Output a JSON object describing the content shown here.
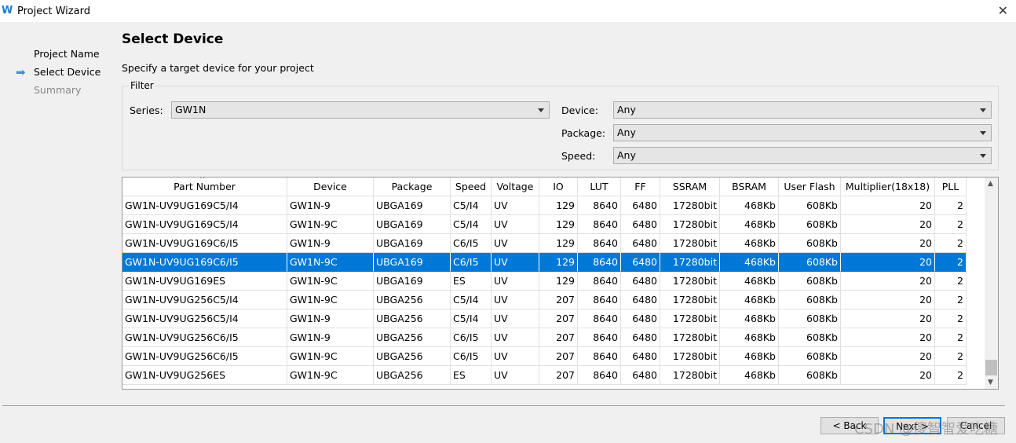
{
  "window": {
    "title": "Project Wizard"
  },
  "steps": [
    {
      "label": "Project Name",
      "state": "done"
    },
    {
      "label": "Select Device",
      "state": "current"
    },
    {
      "label": "Summary",
      "state": "future"
    }
  ],
  "page": {
    "title": "Select Device",
    "subtitle": "Specify a target device for your project"
  },
  "filter": {
    "legend": "Filter",
    "series_label": "Series:",
    "series": "GW1N",
    "device_label": "Device:",
    "device": "Any",
    "package_label": "Package:",
    "package": "Any",
    "speed_label": "Speed:",
    "speed": "Any"
  },
  "table": {
    "columns": [
      "Part Number",
      "Device",
      "Package",
      "Speed",
      "Voltage",
      "IO",
      "LUT",
      "FF",
      "SSRAM",
      "BSRAM",
      "User Flash",
      "Multiplier(18x18)",
      "PLL"
    ],
    "sort_column": "Part Number",
    "selected_row": 3,
    "rows": [
      [
        "GW1N-UV9UG169C5/I4",
        "GW1N-9",
        "UBGA169",
        "C5/I4",
        "UV",
        "129",
        "8640",
        "6480",
        "17280bit",
        "468Kb",
        "608Kb",
        "20",
        "2"
      ],
      [
        "GW1N-UV9UG169C5/I4",
        "GW1N-9C",
        "UBGA169",
        "C5/I4",
        "UV",
        "129",
        "8640",
        "6480",
        "17280bit",
        "468Kb",
        "608Kb",
        "20",
        "2"
      ],
      [
        "GW1N-UV9UG169C6/I5",
        "GW1N-9",
        "UBGA169",
        "C6/I5",
        "UV",
        "129",
        "8640",
        "6480",
        "17280bit",
        "468Kb",
        "608Kb",
        "20",
        "2"
      ],
      [
        "GW1N-UV9UG169C6/I5",
        "GW1N-9C",
        "UBGA169",
        "C6/I5",
        "UV",
        "129",
        "8640",
        "6480",
        "17280bit",
        "468Kb",
        "608Kb",
        "20",
        "2"
      ],
      [
        "GW1N-UV9UG169ES",
        "GW1N-9C",
        "UBGA169",
        "ES",
        "UV",
        "129",
        "8640",
        "6480",
        "17280bit",
        "468Kb",
        "608Kb",
        "20",
        "2"
      ],
      [
        "GW1N-UV9UG256C5/I4",
        "GW1N-9C",
        "UBGA256",
        "C5/I4",
        "UV",
        "207",
        "8640",
        "6480",
        "17280bit",
        "468Kb",
        "608Kb",
        "20",
        "2"
      ],
      [
        "GW1N-UV9UG256C5/I4",
        "GW1N-9",
        "UBGA256",
        "C5/I4",
        "UV",
        "207",
        "8640",
        "6480",
        "17280bit",
        "468Kb",
        "608Kb",
        "20",
        "2"
      ],
      [
        "GW1N-UV9UG256C6/I5",
        "GW1N-9",
        "UBGA256",
        "C6/I5",
        "UV",
        "207",
        "8640",
        "6480",
        "17280bit",
        "468Kb",
        "608Kb",
        "20",
        "2"
      ],
      [
        "GW1N-UV9UG256C6/I5",
        "GW1N-9C",
        "UBGA256",
        "C6/I5",
        "UV",
        "207",
        "8640",
        "6480",
        "17280bit",
        "468Kb",
        "608Kb",
        "20",
        "2"
      ],
      [
        "GW1N-UV9UG256ES",
        "GW1N-9C",
        "UBGA256",
        "ES",
        "UV",
        "207",
        "8640",
        "6480",
        "17280bit",
        "468Kb",
        "608Kb",
        "20",
        "2"
      ]
    ]
  },
  "buttons": {
    "back": "< Back",
    "next": "Next >",
    "cancel": "Cancel"
  },
  "watermark": "CSDN @傻智智爱吃糖",
  "colors": {
    "selection": "#0078d7",
    "accent": "#1e7bd4"
  }
}
